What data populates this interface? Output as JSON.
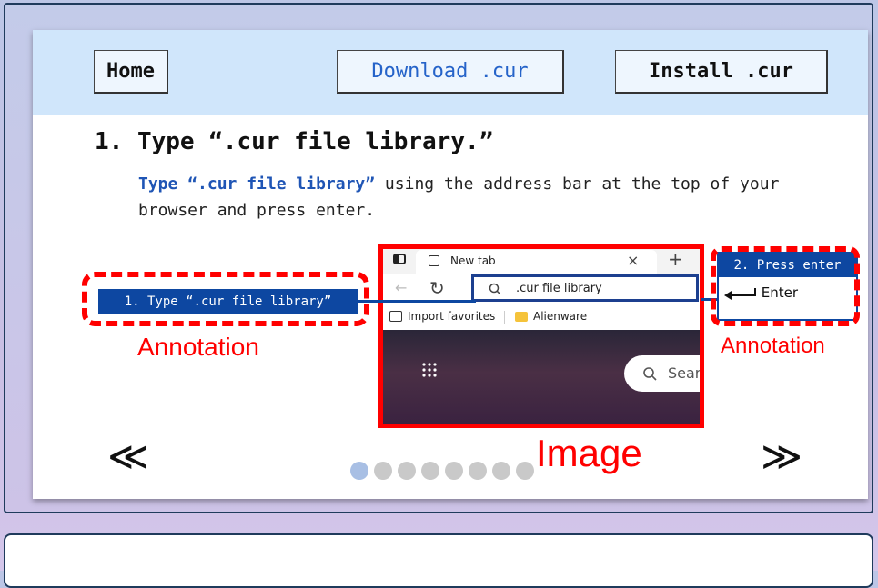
{
  "nav": {
    "home": "Home",
    "download": "Download .cur",
    "install": "Install .cur"
  },
  "step": {
    "title": "1. Type “.cur file library.”",
    "desc_bold": "Type “.cur file library”",
    "desc_rest": " using the address bar at the top of your browser and press enter."
  },
  "browser": {
    "tab_label": "New tab",
    "close_glyph": "×",
    "newtab_glyph": "+",
    "address_value": ".cur file library",
    "fav_import": "Import favorites",
    "fav_folder": "Alienware",
    "search_placeholder": "Sear"
  },
  "annotations": {
    "step1_label": "1. Type “.cur file library”",
    "step2_head": "2. Press enter",
    "step2_body": "Enter",
    "left_caption": "Annotation",
    "right_caption": "Annotation",
    "image_caption": "Image"
  },
  "carousel": {
    "prev": "≪",
    "next": "≫",
    "total": 8,
    "current": 1
  },
  "colors": {
    "accent_blue": "#0d47a1",
    "annotation_red": "#ff0000",
    "nav_bg": "#d0e6fb",
    "link_blue": "#2563c9"
  },
  "icons": [
    "sidebar-icon",
    "newtab-page-icon",
    "back-arrow-icon",
    "refresh-icon",
    "search-icon",
    "import-favorites-icon",
    "folder-icon",
    "apps-grid-icon",
    "enter-key-icon"
  ]
}
